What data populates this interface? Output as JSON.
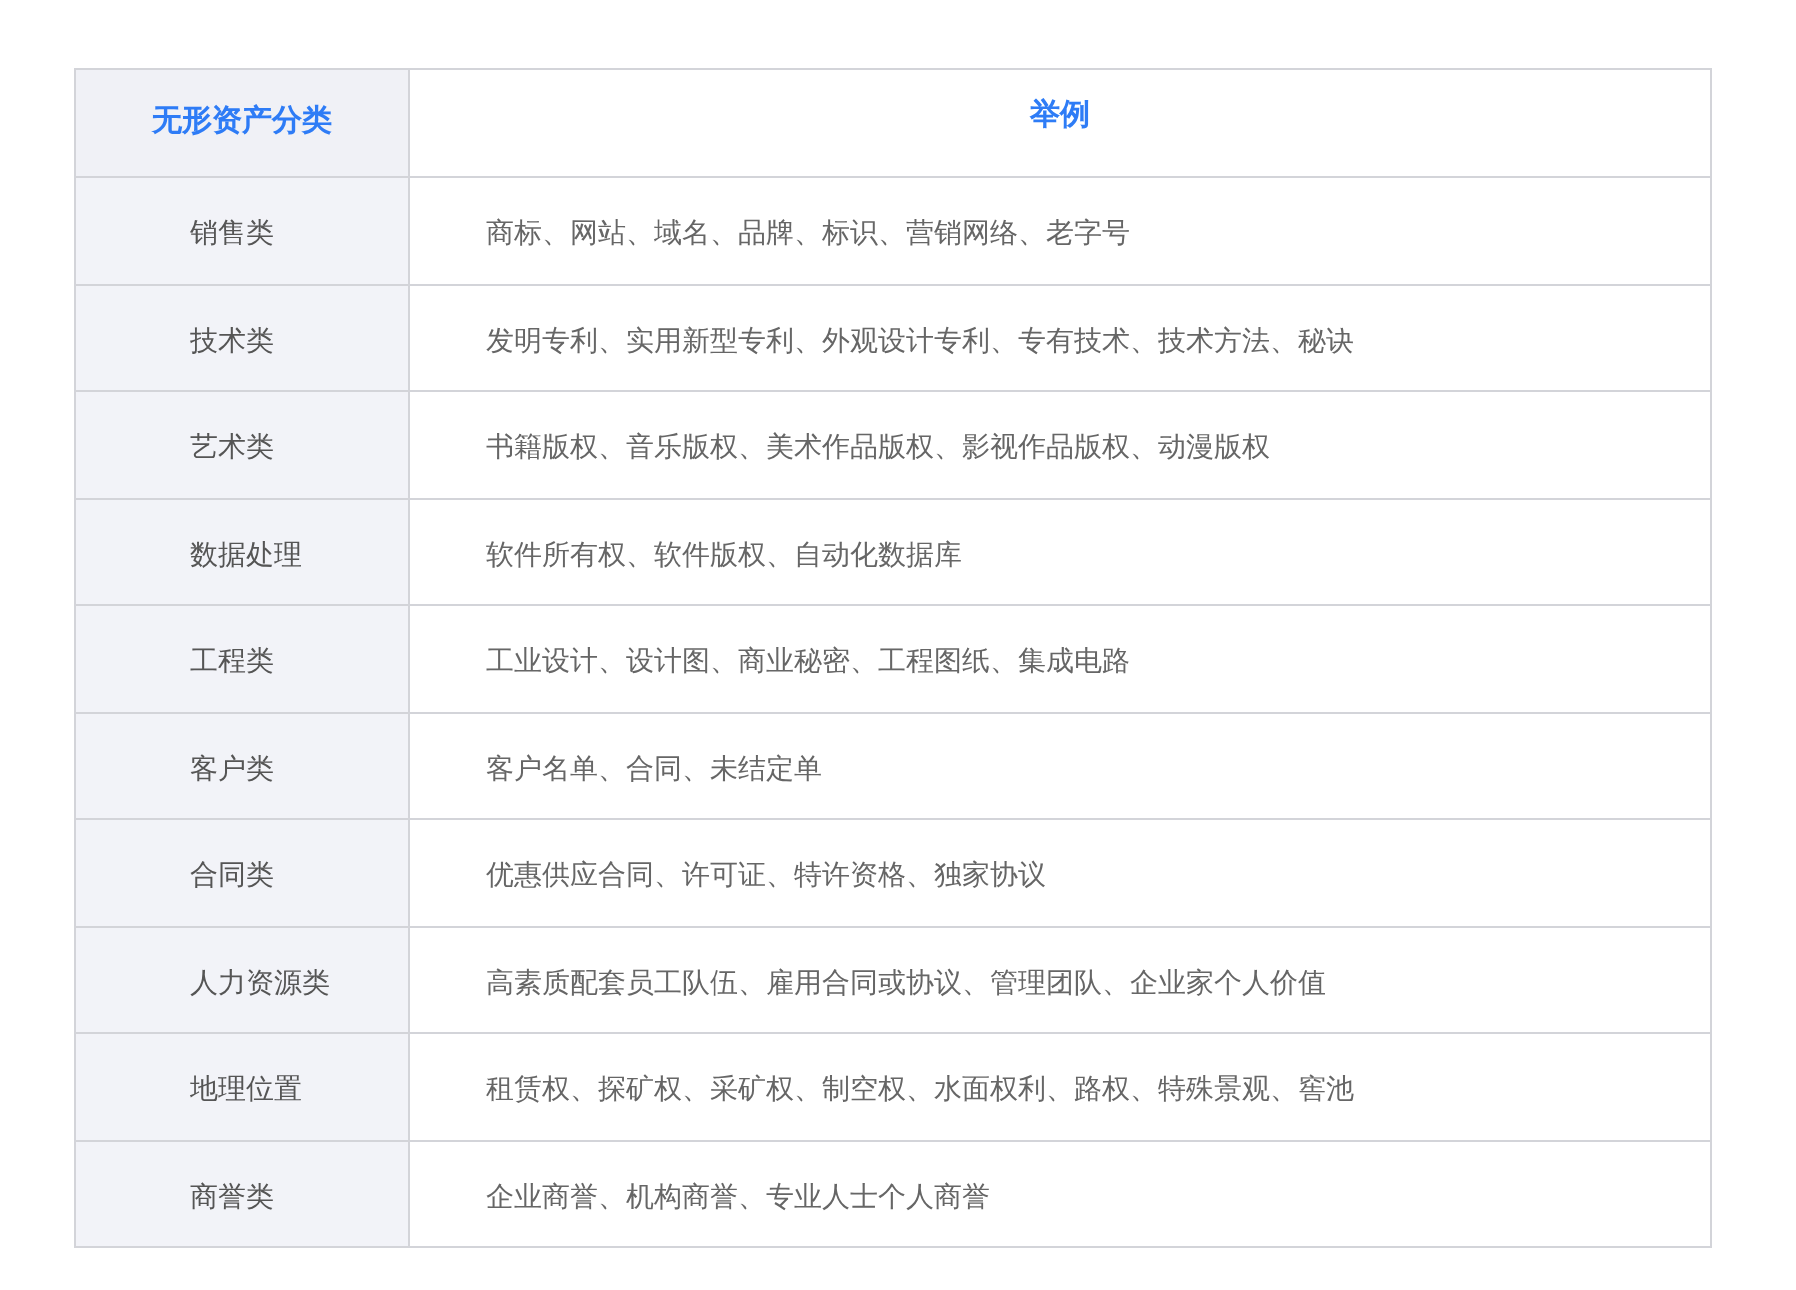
{
  "table": {
    "columns": [
      "无形资产分类",
      "举例"
    ],
    "rows": [
      [
        "销售类",
        "商标、网站、域名、品牌、标识、营销网络、老字号"
      ],
      [
        "技术类",
        "发明专利、实用新型专利、外观设计专利、专有技术、技术方法、秘诀"
      ],
      [
        "艺术类",
        "书籍版权、音乐版权、美术作品版权、影视作品版权、动漫版权"
      ],
      [
        "数据处理",
        "软件所有权、软件版权、自动化数据库"
      ],
      [
        "工程类",
        "工业设计、设计图、商业秘密、工程图纸、集成电路"
      ],
      [
        "客户类",
        "客户名单、合同、未结定单"
      ],
      [
        "合同类",
        "优惠供应合同、许可证、特许资格、独家协议"
      ],
      [
        "人力资源类",
        "高素质配套员工队伍、雇用合同或协议、管理团队、企业家个人价值"
      ],
      [
        "地理位置",
        "租赁权、探矿权、采矿权、制空权、水面权利、路权、特殊景观、窖池"
      ],
      [
        "商誉类",
        "企业商誉、机构商誉、专业人士个人商誉"
      ]
    ]
  }
}
